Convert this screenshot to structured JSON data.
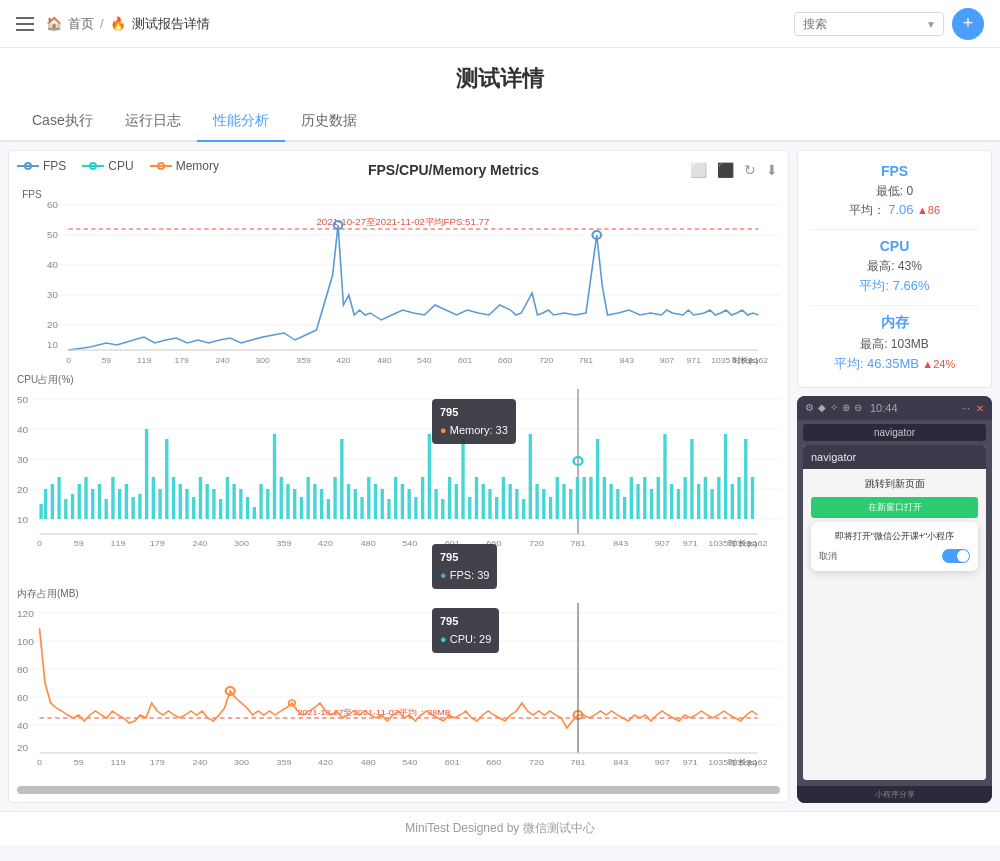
{
  "header": {
    "breadcrumb": {
      "home": "首页",
      "separator": "火",
      "current": "测试报告详情"
    },
    "search_placeholder": "搜索",
    "add_btn_label": "+"
  },
  "page": {
    "title": "测试详情"
  },
  "tabs": [
    {
      "id": "case",
      "label": "Case执行"
    },
    {
      "id": "log",
      "label": "运行日志"
    },
    {
      "id": "perf",
      "label": "性能分析",
      "active": true
    },
    {
      "id": "history",
      "label": "历史数据"
    }
  ],
  "chart": {
    "title": "FPS/CPU/Memory Metrics",
    "legend": {
      "fps_label": "FPS",
      "cpu_label": "CPU",
      "memory_label": "Memory"
    },
    "fps_section": {
      "y_label": "FPS",
      "avg_line_label": "2021-10-27至2021-11-02平均FPS:51.77",
      "x_axis_label": "时长(s)",
      "x_ticks": [
        "0",
        "59",
        "119",
        "179",
        "240",
        "300",
        "359",
        "420",
        "480",
        "540",
        "601",
        "660",
        "720",
        "781",
        "843",
        "907",
        "971",
        "1035",
        "1099",
        "1162"
      ]
    },
    "cpu_section": {
      "y_label": "CPU占用(%)",
      "x_axis_label": "时长(s)",
      "x_ticks": [
        "0",
        "59",
        "119",
        "179",
        "240",
        "300",
        "359",
        "420",
        "480",
        "540",
        "601",
        "660",
        "720",
        "781",
        "843",
        "907",
        "971",
        "1035",
        "1099",
        "1162"
      ]
    },
    "memory_section": {
      "y_label": "内存占用(MB)",
      "avg_line_label": "2021-10-27至2021-11-02平均：38MB",
      "x_axis_label": "时长(s)",
      "x_ticks": [
        "0",
        "59",
        "119",
        "179",
        "240",
        "300",
        "359",
        "420",
        "480",
        "540",
        "601",
        "660",
        "720",
        "781",
        "843",
        "907",
        "971",
        "1035",
        "1099",
        "1162"
      ]
    },
    "tooltip": {
      "time": "795",
      "memory_label": "Memory: 33",
      "fps_label": "FPS: 39",
      "cpu_label": "CPU: 29"
    }
  },
  "stats": {
    "fps": {
      "title": "FPS",
      "min_label": "最低: 0",
      "avg_label": "平均：",
      "avg_value": "7.06",
      "avg_badge": "▲86"
    },
    "cpu": {
      "title": "CPU",
      "max_label": "最高: 43%",
      "avg_label": "平均: 7.66%"
    },
    "memory": {
      "title": "内存",
      "max_label": "最高: 103MB",
      "avg_label": "平均: 46.35MB",
      "avg_badge": "▲24%"
    }
  },
  "device": {
    "url": "navigator",
    "nav_title": "navigator",
    "subtitle1": "跳转到新页面",
    "subtitle2": "在新窗口打开",
    "dialog_title": "即将打开\"微信公开课+\"小程序",
    "dialog_cancel": "取消",
    "footer": "小程序分享"
  },
  "footer": {
    "text": "MiniTest Designed by 微信测试中心"
  }
}
